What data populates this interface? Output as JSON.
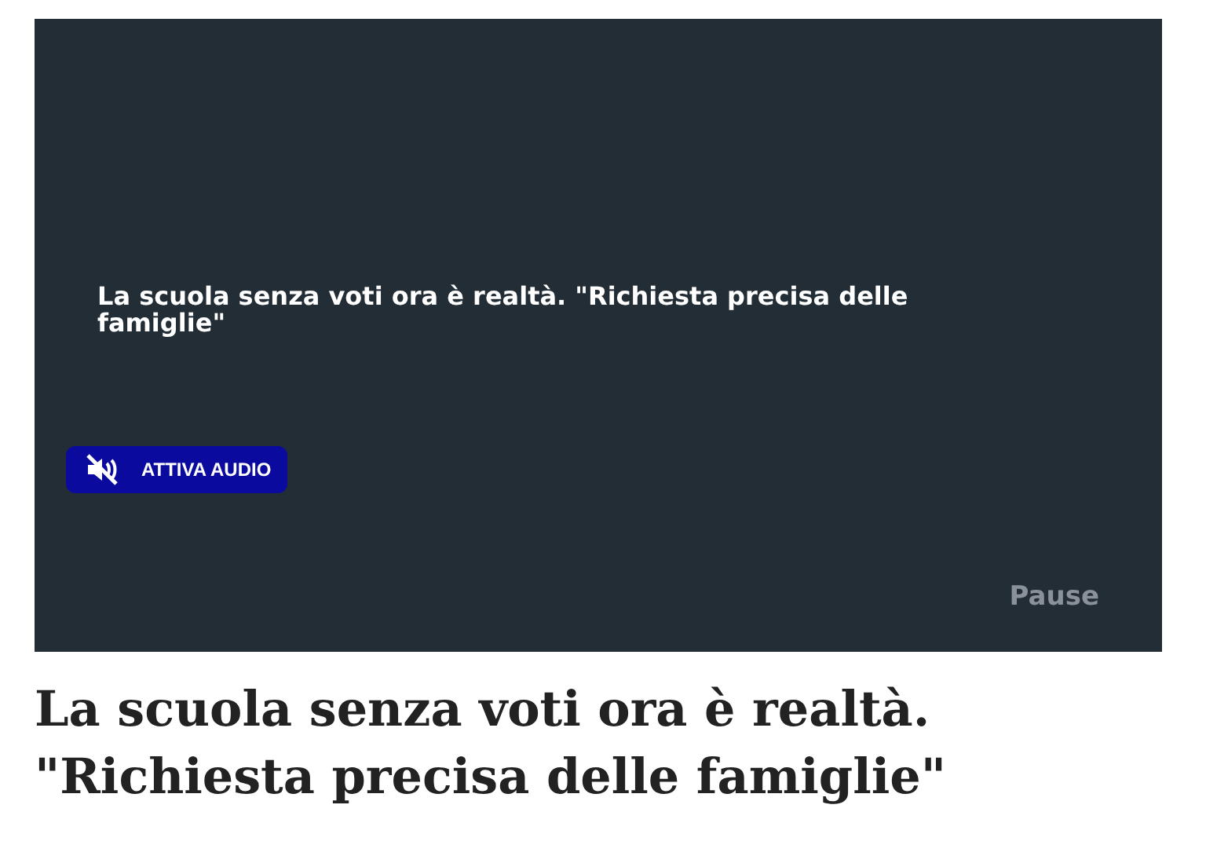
{
  "video": {
    "caption": "La scuola senza voti ora è realtà. \"Richiesta precisa delle famiglie\"",
    "audio_button": {
      "label": "ATTIVA AUDIO",
      "muted": true
    },
    "pause_label": "Pause"
  },
  "headline": "La scuola senza voti ora è realtà. \"Richiesta precisa delle famiglie\""
}
